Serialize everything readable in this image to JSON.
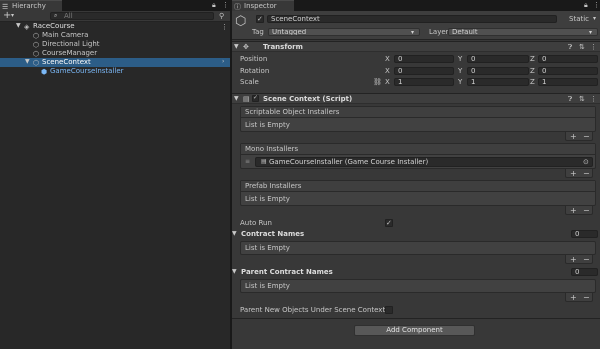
{
  "hierarchy": {
    "tab_title": "Hierarchy",
    "add_label": "+",
    "add_dropdown": "▾",
    "search_placeholder": "All",
    "items": [
      {
        "label": "RaceCourse"
      },
      {
        "label": "Main Camera"
      },
      {
        "label": "Directional Light"
      },
      {
        "label": "CourseManager"
      },
      {
        "label": "SceneContext"
      },
      {
        "label": "GameCourseInstaller"
      }
    ]
  },
  "inspector": {
    "tab_title": "Inspector",
    "object_name": "SceneContext",
    "static_label": "Static",
    "tag_label": "Tag",
    "tag_value": "Untagged",
    "layer_label": "Layer",
    "layer_value": "Default",
    "transform": {
      "title": "Transform",
      "rows": [
        {
          "label": "Position",
          "x": "0",
          "y": "0",
          "z": "0"
        },
        {
          "label": "Rotation",
          "x": "0",
          "y": "0",
          "z": "0"
        },
        {
          "label": "Scale",
          "x": "1",
          "y": "1",
          "z": "1"
        }
      ],
      "axis_x": "X",
      "axis_y": "Y",
      "axis_z": "Z"
    },
    "scene_context": {
      "title": "Scene Context (Script)",
      "scriptable_label": "Scriptable Object Installers",
      "scriptable_empty": "List is Empty",
      "mono_label": "Mono Installers",
      "mono_item": "GameCourseInstaller (Game Course Installer)",
      "prefab_label": "Prefab Installers",
      "prefab_empty": "List is Empty",
      "auto_run_label": "Auto Run",
      "auto_run_checked": true,
      "contract_label": "Contract Names",
      "contract_count": "0",
      "contract_empty": "List is Empty",
      "parent_contract_label": "Parent Contract Names",
      "parent_contract_count": "0",
      "parent_contract_empty": "List is Empty",
      "parent_objects_label": "Parent New Objects Under Scene Context",
      "parent_objects_checked": false
    },
    "add_component_label": "Add Component",
    "plus_label": "+",
    "minus_label": "−"
  },
  "colors": {
    "selection": "#2c5d87",
    "prefab_text": "#7bb8f6"
  }
}
